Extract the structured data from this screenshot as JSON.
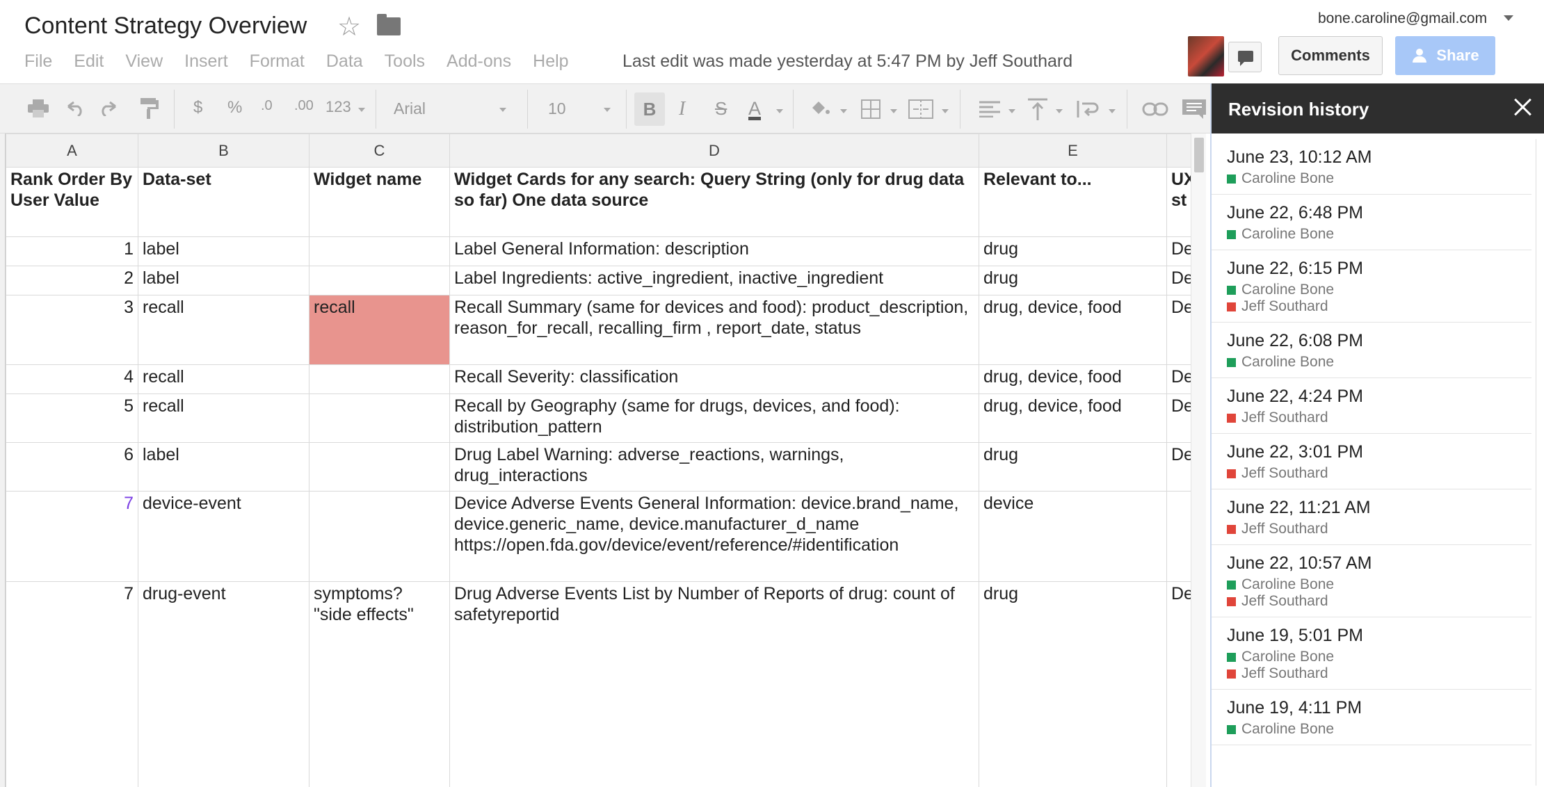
{
  "header": {
    "title": "Content Strategy Overview",
    "menu": [
      "File",
      "Edit",
      "View",
      "Insert",
      "Format",
      "Data",
      "Tools",
      "Add-ons",
      "Help"
    ],
    "last_edit": "Last edit was made yesterday at 5:47 PM by Jeff Southard",
    "account": "bone.caroline@gmail.com",
    "comments_label": "Comments",
    "share_label": "Share"
  },
  "toolbar": {
    "currency": "$",
    "percent": "%",
    "dec_decrease": ".0",
    "dec_increase": ".00",
    "number_format": "123",
    "font": "Arial",
    "font_size": "10",
    "bold": "B",
    "italic": "I",
    "strike": "S",
    "text_color": "A"
  },
  "sheet": {
    "columns": [
      "A",
      "B",
      "C",
      "D",
      "E",
      ""
    ],
    "header_row": [
      "Rank Order By User Value",
      "Data-set",
      "Widget name",
      "Widget Cards for any search: Query String (only for drug data so far) One data source",
      "Relevant to...",
      "UX st"
    ],
    "rows": [
      [
        "1",
        "label",
        "",
        "Label General Information: description",
        "drug",
        "De"
      ],
      [
        "2",
        "label",
        "",
        "Label Ingredients: active_ingredient, inactive_ingredient",
        "drug",
        "De"
      ],
      [
        "3",
        "recall",
        "recall",
        "Recall Summary (same for devices and food): product_description, reason_for_recall, recalling_firm , report_date, status",
        "drug, device, food",
        "De"
      ],
      [
        "4",
        "recall",
        "",
        "Recall Severity: classification",
        "drug, device, food",
        "De"
      ],
      [
        "5",
        "recall",
        "",
        "Recall by Geography (same for drugs, devices, and food): distribution_pattern",
        "drug, device, food",
        "De"
      ],
      [
        "6",
        "label",
        "",
        "Drug Label Warning: adverse_reactions, warnings, drug_interactions",
        "drug",
        "De"
      ],
      [
        "7",
        "device-event",
        "",
        "Device Adverse Events General Information: device.brand_name, device.generic_name, device.manufacturer_d_name https://open.fda.gov/device/event/reference/#identification",
        "device",
        ""
      ],
      [
        "7",
        "drug-event",
        "symptoms? \"side effects\"",
        "Drug Adverse Events List by Number of Reports of drug: count of safetyreportid",
        "drug",
        "De"
      ]
    ]
  },
  "revision_history": {
    "title": "Revision history",
    "colors": {
      "caroline": "#1e9e5a",
      "jeff": "#e0453a"
    },
    "items": [
      {
        "time": "June 23, 10:12 AM",
        "users": [
          {
            "name": "Caroline Bone",
            "color": "#1e9e5a"
          }
        ]
      },
      {
        "time": "June 22, 6:48 PM",
        "users": [
          {
            "name": "Caroline Bone",
            "color": "#1e9e5a"
          }
        ]
      },
      {
        "time": "June 22, 6:15 PM",
        "users": [
          {
            "name": "Caroline Bone",
            "color": "#1e9e5a"
          },
          {
            "name": "Jeff Southard",
            "color": "#e0453a"
          }
        ]
      },
      {
        "time": "June 22, 6:08 PM",
        "users": [
          {
            "name": "Caroline Bone",
            "color": "#1e9e5a"
          }
        ]
      },
      {
        "time": "June 22, 4:24 PM",
        "users": [
          {
            "name": "Jeff Southard",
            "color": "#e0453a"
          }
        ]
      },
      {
        "time": "June 22, 3:01 PM",
        "users": [
          {
            "name": "Jeff Southard",
            "color": "#e0453a"
          }
        ]
      },
      {
        "time": "June 22, 11:21 AM",
        "users": [
          {
            "name": "Jeff Southard",
            "color": "#e0453a"
          }
        ]
      },
      {
        "time": "June 22, 10:57 AM",
        "users": [
          {
            "name": "Caroline Bone",
            "color": "#1e9e5a"
          },
          {
            "name": "Jeff Southard",
            "color": "#e0453a"
          }
        ]
      },
      {
        "time": "June 19, 5:01 PM",
        "users": [
          {
            "name": "Caroline Bone",
            "color": "#1e9e5a"
          },
          {
            "name": "Jeff Southard",
            "color": "#e0453a"
          }
        ]
      },
      {
        "time": "June 19, 4:11 PM",
        "users": [
          {
            "name": "Caroline Bone",
            "color": "#1e9e5a"
          }
        ]
      }
    ]
  }
}
